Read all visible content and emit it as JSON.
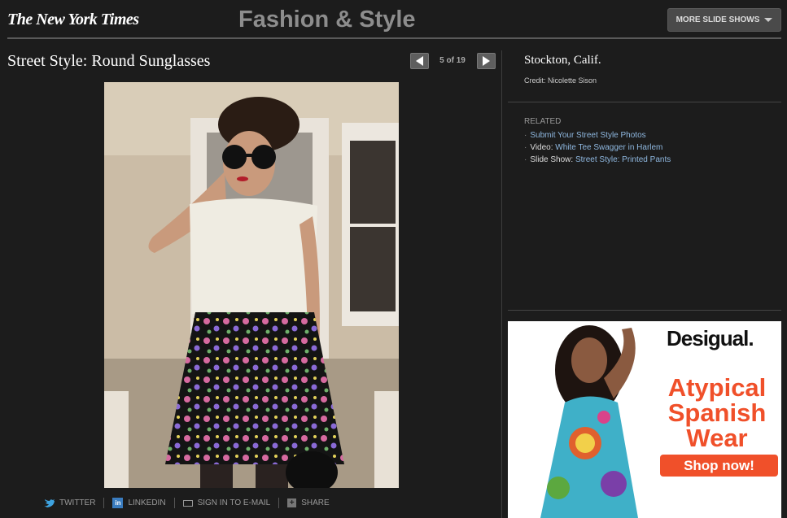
{
  "header": {
    "logo": "The New York Times",
    "section_title": "Fashion & Style",
    "more_button": "MORE SLIDE SHOWS"
  },
  "slideshow": {
    "title": "Street Style: Round Sunglasses",
    "counter": "5 of 19"
  },
  "share": {
    "twitter": "TWITTER",
    "linkedin": "LINKEDIN",
    "email": "SIGN IN TO E-MAIL",
    "share": "SHARE",
    "linkedin_icon_text": "in"
  },
  "caption": {
    "location": "Stockton, Calif.",
    "credit": "Credit: Nicolette Sison"
  },
  "related": {
    "label": "RELATED",
    "items": [
      {
        "prefix": "",
        "link": "Submit Your Street Style Photos"
      },
      {
        "prefix": "Video: ",
        "link": "White Tee Swagger in Harlem"
      },
      {
        "prefix": "Slide Show: ",
        "link": "Street Style: Printed Pants"
      }
    ]
  },
  "ad": {
    "brand": "Desigual.",
    "tagline_1": "Atypical",
    "tagline_2": "Spanish",
    "tagline_3": "Wear",
    "cta": "Shop now!"
  },
  "colors": {
    "background": "#1c1c1c",
    "link": "#8fb8e0",
    "ad_accent": "#f0502a"
  }
}
